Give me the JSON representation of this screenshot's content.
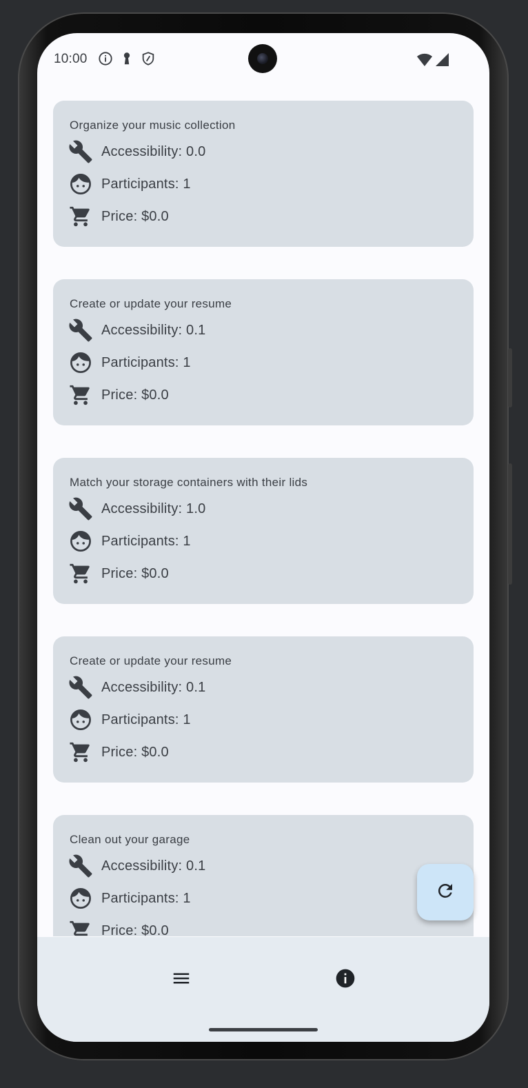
{
  "status_bar": {
    "time": "10:00",
    "left_icons": [
      "info-icon",
      "keyhole-icon",
      "shield-icon"
    ],
    "right_icons": [
      "wifi-icon",
      "cell-signal-icon"
    ]
  },
  "activities": [
    {
      "title": "Organize your music collection",
      "accessibility": "Accessibility: 0.0",
      "participants": "Participants: 1",
      "price": "Price: $0.0"
    },
    {
      "title": "Create or update your resume",
      "accessibility": "Accessibility: 0.1",
      "participants": "Participants: 1",
      "price": "Price: $0.0"
    },
    {
      "title": "Match your storage containers with their lids",
      "accessibility": "Accessibility: 1.0",
      "participants": "Participants: 1",
      "price": "Price: $0.0"
    },
    {
      "title": "Create or update your resume",
      "accessibility": "Accessibility: 0.1",
      "participants": "Participants: 1",
      "price": "Price: $0.0"
    },
    {
      "title": "Clean out your garage",
      "accessibility": "Accessibility: 0.1",
      "participants": "Participants: 1",
      "price": "Price: $0.0"
    }
  ],
  "row_icons": {
    "accessibility": "wrench-icon",
    "participants": "face-icon",
    "price": "shopping-cart-icon"
  },
  "fab": {
    "icon": "refresh-icon"
  },
  "bottom_nav": {
    "left_icon": "menu-icon",
    "right_icon": "info-icon"
  },
  "colors": {
    "screen_bg": "#fbfbfe",
    "card_bg": "#d8dee4",
    "fab_bg": "#cde5f8",
    "bottom_bar_bg": "#e5ebf1",
    "text": "#3a3e44"
  }
}
